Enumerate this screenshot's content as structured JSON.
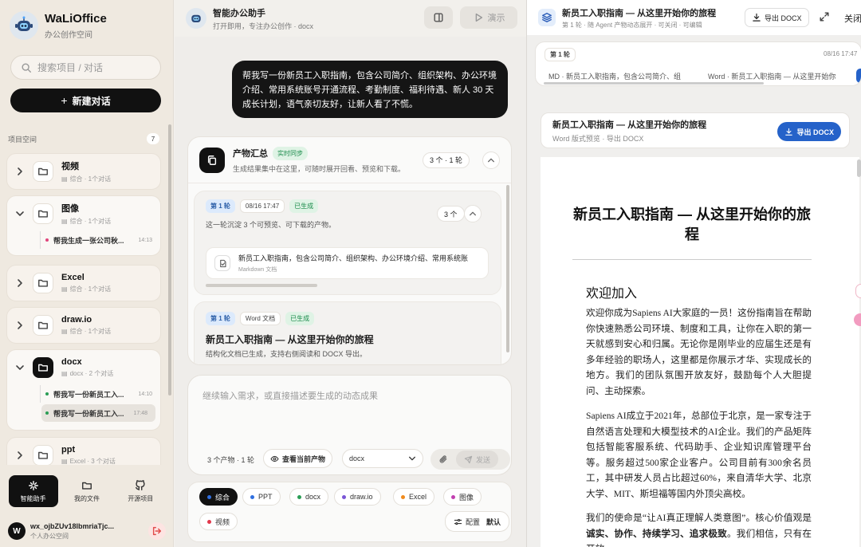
{
  "sidebar": {
    "brand": {
      "name": "WaLiOffice",
      "subtitle": "办公创作空间",
      "logo": "robot-icon"
    },
    "search_placeholder": "搜索项目 / 对话",
    "new_chat": "新建对话",
    "section_title": "项目空间",
    "section_count": "7",
    "projects": [
      {
        "name": "视频",
        "meta": "综合 · 1个对话",
        "expanded": false
      },
      {
        "name": "图像",
        "meta": "综合 · 1个对话",
        "expanded": true,
        "items": [
          {
            "title": "帮我生成一张公司秋...",
            "time": "14:13",
            "dot": "#e0457b"
          }
        ]
      },
      {
        "name": "Excel",
        "meta": "综合 · 1个对话",
        "expanded": false
      },
      {
        "name": "draw.io",
        "meta": "综合 · 1个对话",
        "expanded": false
      },
      {
        "name": "docx",
        "meta": "docx · 2 个对话",
        "expanded": true,
        "items": [
          {
            "title": "帮我写一份新员工入...",
            "time": "14:10",
            "dot": "#2a9d55"
          },
          {
            "title": "帮我写一份新员工入...",
            "time": "17:48",
            "dot": "#2a9d55"
          }
        ]
      },
      {
        "name": "ppt",
        "meta": "Excel · 3 个对话",
        "expanded": false
      }
    ],
    "nav": [
      {
        "label": "智能助手",
        "icon": "sparkle-icon"
      },
      {
        "label": "我的文件",
        "icon": "folder-icon"
      },
      {
        "label": "开源项目",
        "icon": "github-icon"
      }
    ],
    "user": {
      "initial": "W",
      "name": "wx_ojbZUv18lbmriaTjc...",
      "sub": "个人办公空间"
    }
  },
  "center": {
    "title": "智能办公助手",
    "subtitle": "打开即用，专注办公创作 · docx",
    "demo_label": "演示",
    "user_message": "帮我写一份新员工入职指南，包含公司简介、组织架构、办公环境介绍、常用系统账号开通流程、考勤制度、福利待遇、新人 30 天成长计划，语气亲切友好，让新人看了不慌。",
    "summary": {
      "title": "产物汇总",
      "badge": "实时同步",
      "subtitle": "生成结果集中在这里，可随时展开回看、预览和下载。",
      "count": "3 个 · 1 轮"
    },
    "turn1": {
      "round": "第 1 轮",
      "time": "08/16 17:47",
      "status": "已生成",
      "desc": "这一轮沉淀 3 个可预览、可下载的产物。",
      "count": "3 个",
      "file_name": "新员工入职指南，包含公司简介、组织架构、办公环境介绍、常用系统账",
      "file_type": "Markdown 文档"
    },
    "turn2": {
      "round": "第 1 轮",
      "type": "Word 文档",
      "status": "已生成",
      "title": "新员工入职指南 — 从这里开始你的旅程",
      "desc": "结构化文档已生成，支持右侧阅读和 DOCX 导出。"
    },
    "composer": {
      "placeholder": "继续输入需求，或直接描述要生成的动态成果",
      "count": "3 个产物 · 1 轮",
      "view_label": "查看当前产物",
      "select_value": "docx",
      "send_label": "发送"
    },
    "chips": [
      {
        "label": "综合",
        "color": "#2f6fe0",
        "active": true
      },
      {
        "label": "PPT",
        "color": "#2f6fe0",
        "active": false
      },
      {
        "label": "docx",
        "color": "#2a9d55",
        "active": false
      },
      {
        "label": "draw.io",
        "color": "#7a55d6",
        "active": false
      },
      {
        "label": "Excel",
        "color": "#f08a1c",
        "active": false
      },
      {
        "label": "图像",
        "color": "#c13fb0",
        "active": false
      },
      {
        "label": "视频",
        "color": "#e2374a",
        "active": false
      }
    ],
    "config_label": "配置",
    "config_value": "默认"
  },
  "right": {
    "title": "新员工入职指南 — 从这里开始你的旅程",
    "subtitle": "第 1 轮 · 随 Agent 产物动态展开 · 可关闭 · 可编辑",
    "export_label": "导出 DOCX",
    "close_label": "关闭",
    "strip": {
      "round": "第 1 轮",
      "date": "08/16 17:47",
      "tabs": [
        "MD · 新员工入职指南，包含公司简介、组",
        "Word · 新员工入职指南 — 从这里开始你"
      ]
    },
    "preview": {
      "title": "新员工入职指南 — 从这里开始你的旅程",
      "sub": "Word 版式预览 · 导出 DOCX",
      "export_label": "导出 DOCX"
    },
    "doc": {
      "h1": "新员工入职指南 — 从这里开始你的旅程",
      "h2": "欢迎加入",
      "p1": "欢迎你成为Sapiens AI大家庭的一员！这份指南旨在帮助你快速熟悉公司环境、制度和工具，让你在入职的第一天就感到安心和归属。无论你是刚毕业的应届生还是有多年经验的职场人，这里都是你展示才华、实现成长的地方。我们的团队氛围开放友好，鼓励每个人大胆提问、主动探索。",
      "p2": "Sapiens AI成立于2021年，总部位于北京，是一家专注于自然语言处理和大模型技术的AI企业。我们的产品矩阵包括智能客服系统、代码助手、企业知识库管理平台等。服务超过500家企业客户。公司目前有300余名员工，其中研发人员占比超过60%，来自清华大学、北京大学、MIT、斯坦福等国内外顶尖高校。",
      "p3a": "我们的使命是“让AI真正理解人类意图”。核心价值观是",
      "p3b": "诚实、协作、持续学习、追求极致",
      "p3c": "。我们相信，只有在开放"
    }
  }
}
